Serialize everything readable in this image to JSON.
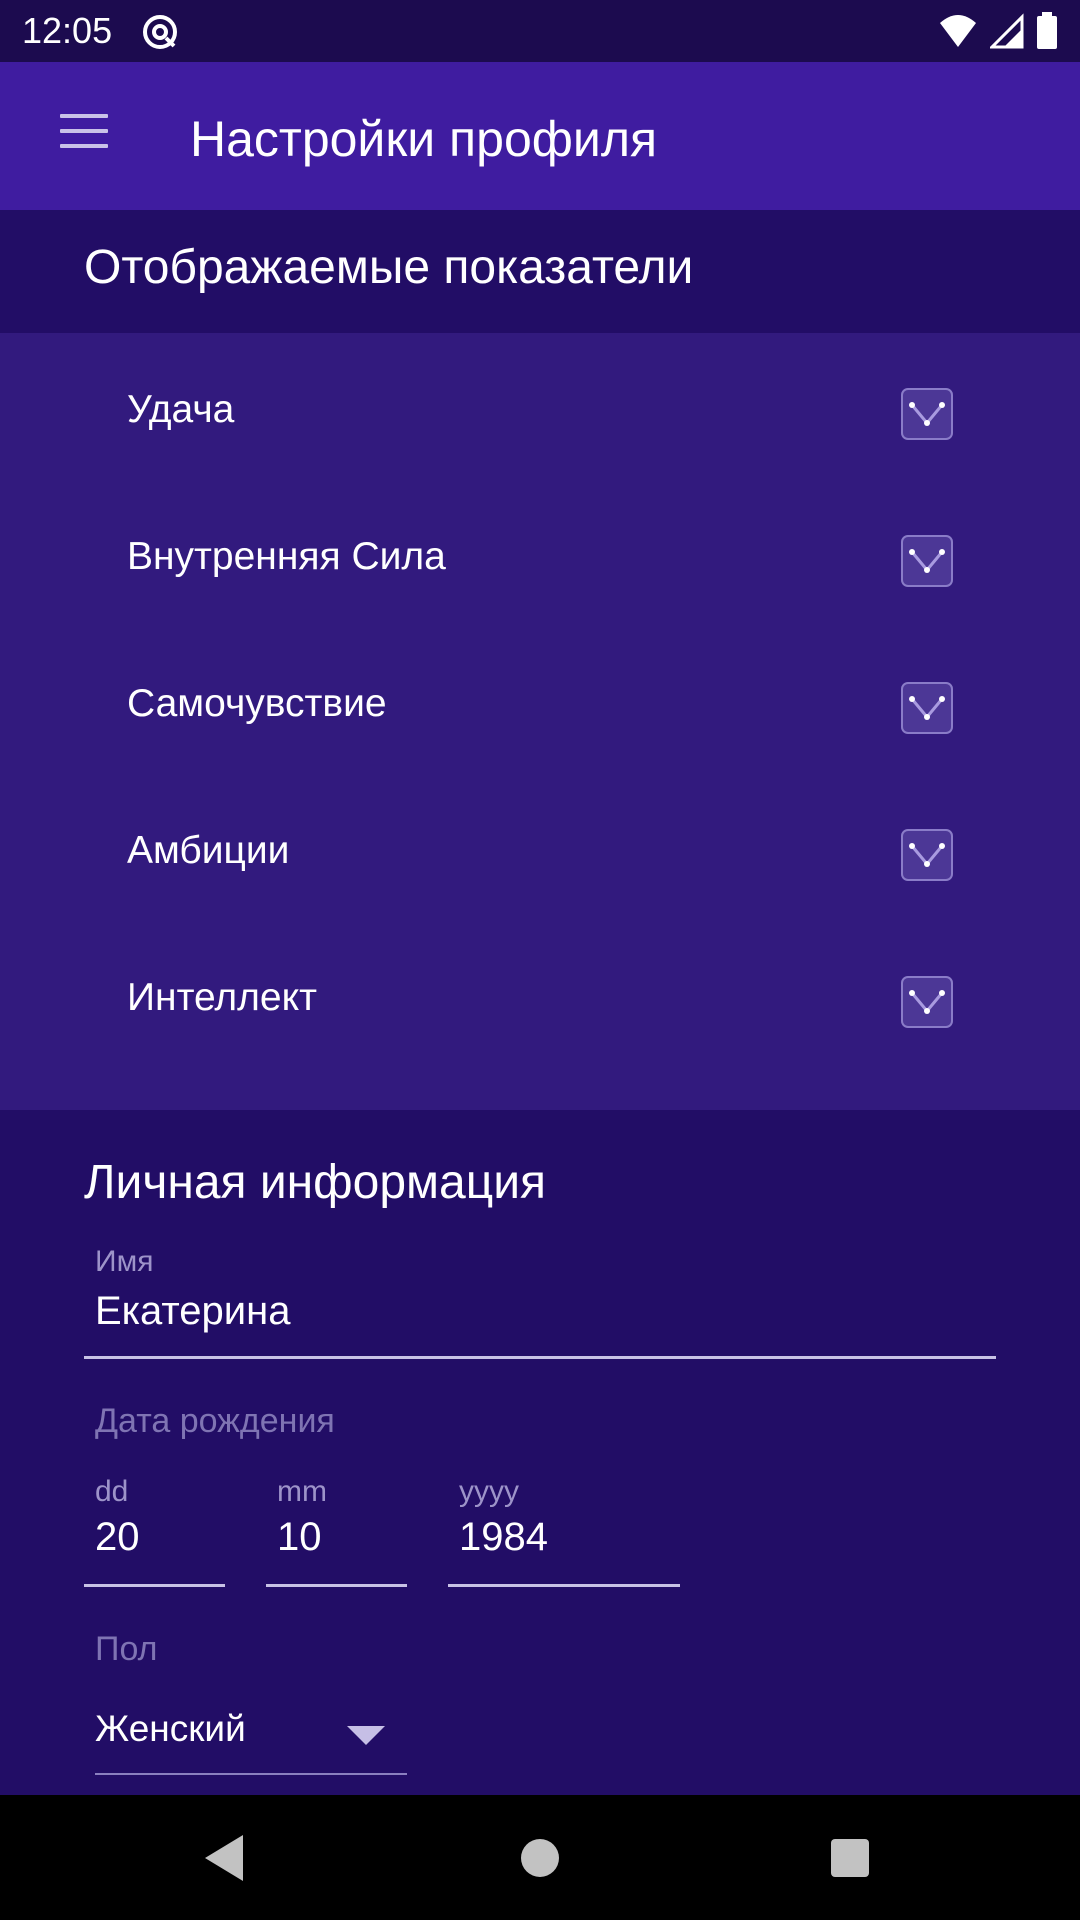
{
  "status_bar": {
    "time": "12:05",
    "app_icon": "at-sign-icon",
    "wifi_icon": "wifi-icon",
    "signal_icon": "cell-signal-icon",
    "battery_icon": "battery-icon"
  },
  "app_bar": {
    "title": "Настройки профиля",
    "menu_icon": "hamburger-menu-icon"
  },
  "indicators": {
    "title": "Отображаемые показатели",
    "items": [
      {
        "label": "Удача",
        "checked": true
      },
      {
        "label": "Внутренняя Сила",
        "checked": true
      },
      {
        "label": "Самочувствие",
        "checked": true
      },
      {
        "label": "Амбиции",
        "checked": true
      },
      {
        "label": "Интеллект",
        "checked": true
      }
    ]
  },
  "personal": {
    "title": "Личная информация",
    "name_label": "Имя",
    "name_value": "Екатерина",
    "birth_label": "Дата рождения",
    "day_label": "dd",
    "day_value": "20",
    "month_label": "mm",
    "month_value": "10",
    "year_label": "yyyy",
    "year_value": "1984",
    "gender_label": "Пол",
    "gender_value": "Женский"
  },
  "nav_bar": {
    "back_icon": "back-triangle-icon",
    "home_icon": "home-circle-icon",
    "recents_icon": "recents-square-icon"
  },
  "colors": {
    "status_bar": "#1c0b4f",
    "app_bar": "#3f1ca0",
    "section_dark": "#220d66",
    "indicators_bg": "#321a7e",
    "nav_bar": "#000000"
  }
}
